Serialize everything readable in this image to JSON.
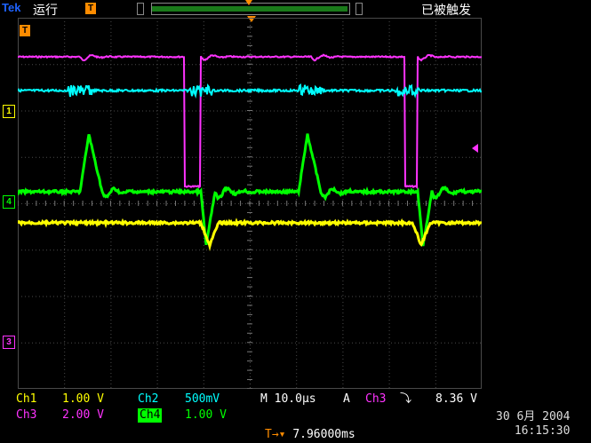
{
  "header": {
    "brand": "Tek",
    "run_state": "运行",
    "trigger_state": "已被触发",
    "trigger_badge": "T"
  },
  "channels": [
    {
      "id": "Ch1",
      "label": "Ch1",
      "scale": "1.00 V",
      "color": "#ffff00",
      "marker": "1"
    },
    {
      "id": "Ch2",
      "label": "Ch2",
      "scale": "500mV",
      "color": "#00ffff",
      "marker": ""
    },
    {
      "id": "Ch3",
      "label": "Ch3",
      "scale": "2.00 V",
      "color": "#ff33ff",
      "marker": "3"
    },
    {
      "id": "Ch4",
      "label": "Ch4",
      "scale": "1.00 V",
      "color": "#00ff00",
      "marker": "4"
    }
  ],
  "timebase": {
    "label": "M 10.0µs"
  },
  "trigger": {
    "mode": "A",
    "source": "Ch3",
    "slope_icon": "falling-edge-icon",
    "slope_glyph": "⤵",
    "level": "8.36 V",
    "position": "7.96000ms",
    "position_glyph": "T→▾"
  },
  "datetime": {
    "date": "30 6月  2004",
    "time": "16:15:30"
  },
  "colors": {
    "grid": "#4a4a4a",
    "ch1": "#ffff00",
    "ch2": "#00ffff",
    "ch3": "#ff33ff",
    "ch4": "#00ff00",
    "trigger": "#ff8c00",
    "timebase_text": "#ffffff"
  }
}
